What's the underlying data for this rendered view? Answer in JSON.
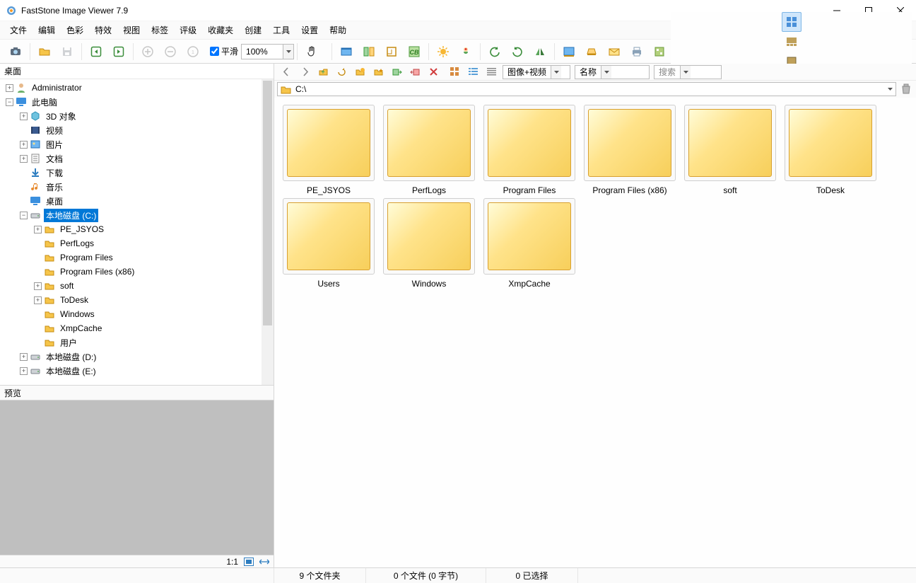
{
  "window": {
    "title": "FastStone Image Viewer 7.9"
  },
  "menu": [
    "文件",
    "编辑",
    "色彩",
    "特效",
    "视图",
    "标签",
    "评级",
    "收藏夹",
    "创建",
    "工具",
    "设置",
    "帮助"
  ],
  "toolbar": {
    "smooth_label": "平滑",
    "zoom_value": "100%"
  },
  "left": {
    "root": "桌面",
    "preview_label": "预览",
    "ratio_label": "1:1",
    "tree": [
      {
        "pad": 8,
        "exp": "+",
        "icon": "user",
        "label": "Administrator"
      },
      {
        "pad": 8,
        "exp": "-",
        "icon": "pc",
        "label": "此电脑"
      },
      {
        "pad": 28,
        "exp": "+",
        "icon": "obj3d",
        "label": "3D 对象"
      },
      {
        "pad": 28,
        "exp": "",
        "icon": "video",
        "label": "视频"
      },
      {
        "pad": 28,
        "exp": "+",
        "icon": "pic",
        "label": "图片"
      },
      {
        "pad": 28,
        "exp": "+",
        "icon": "doc",
        "label": "文档"
      },
      {
        "pad": 28,
        "exp": "",
        "icon": "down",
        "label": "下载"
      },
      {
        "pad": 28,
        "exp": "",
        "icon": "music",
        "label": "音乐"
      },
      {
        "pad": 28,
        "exp": "",
        "icon": "desk",
        "label": "桌面"
      },
      {
        "pad": 28,
        "exp": "-",
        "icon": "drive",
        "label": "本地磁盘 (C:)",
        "sel": true
      },
      {
        "pad": 48,
        "exp": "+",
        "icon": "folder",
        "label": "PE_JSYOS"
      },
      {
        "pad": 48,
        "exp": "",
        "icon": "folder",
        "label": "PerfLogs"
      },
      {
        "pad": 48,
        "exp": "",
        "icon": "folder",
        "label": "Program Files"
      },
      {
        "pad": 48,
        "exp": "",
        "icon": "folder",
        "label": "Program Files (x86)"
      },
      {
        "pad": 48,
        "exp": "+",
        "icon": "folder",
        "label": "soft"
      },
      {
        "pad": 48,
        "exp": "+",
        "icon": "folder",
        "label": "ToDesk"
      },
      {
        "pad": 48,
        "exp": "",
        "icon": "folder",
        "label": "Windows"
      },
      {
        "pad": 48,
        "exp": "",
        "icon": "folder",
        "label": "XmpCache"
      },
      {
        "pad": 48,
        "exp": "",
        "icon": "folder",
        "label": "用户"
      },
      {
        "pad": 28,
        "exp": "+",
        "icon": "drive",
        "label": "本地磁盘 (D:)"
      },
      {
        "pad": 28,
        "exp": "+",
        "icon": "drive",
        "label": "本地磁盘 (E:)"
      }
    ]
  },
  "nav": {
    "filter_label": "图像+视频",
    "sort_label": "名称",
    "search_placeholder": "搜索"
  },
  "addr": {
    "path": "C:\\"
  },
  "folders": [
    "PE_JSYOS",
    "PerfLogs",
    "Program Files",
    "Program Files (x86)",
    "soft",
    "ToDesk",
    "Users",
    "Windows",
    "XmpCache"
  ],
  "status": {
    "folders": "9 个文件夹",
    "files": "0 个文件 (0 字节)",
    "selected": "0 已选择"
  }
}
